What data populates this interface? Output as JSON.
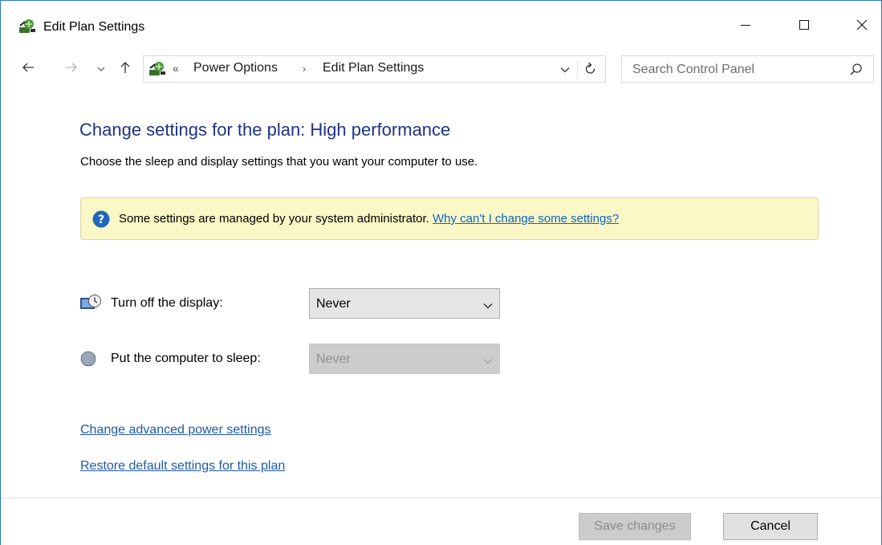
{
  "window": {
    "title": "Edit Plan Settings",
    "icons": {
      "app": "power-options-icon",
      "minimize": "minimize-icon",
      "maximize": "maximize-icon",
      "close": "close-icon"
    }
  },
  "nav": {
    "icons": {
      "back": "arrow-left-icon",
      "forward": "arrow-right-icon",
      "recent": "chevron-down-icon",
      "up": "arrow-up-icon"
    },
    "address": {
      "overflow": "«",
      "crumbs": [
        "Power Options",
        "Edit Plan Settings"
      ],
      "separator": "›"
    },
    "search": {
      "placeholder": "Search Control Panel"
    }
  },
  "content": {
    "title": "Change settings for the plan: High performance",
    "subtitle": "Choose the sleep and display settings that you want your computer to use.",
    "info": {
      "text": "Some settings are managed by your system administrator. ",
      "link": "Why can't I change some settings?"
    },
    "settings": [
      {
        "label": "Turn off the display:",
        "value": "Never",
        "enabled": true,
        "icon": "display-timer-icon"
      },
      {
        "label": "Put the computer to sleep:",
        "value": "Never",
        "enabled": false,
        "icon": "sleep-moon-icon"
      }
    ],
    "links": {
      "advanced": "Change advanced power settings",
      "restore": "Restore default settings for this plan"
    }
  },
  "footer": {
    "save": "Save changes",
    "cancel": "Cancel"
  },
  "colors": {
    "title_blue": "#1e3287",
    "link_blue": "#1e5aa8",
    "info_bg": "#fbf7c7",
    "info_icon": "#1f67b8"
  }
}
